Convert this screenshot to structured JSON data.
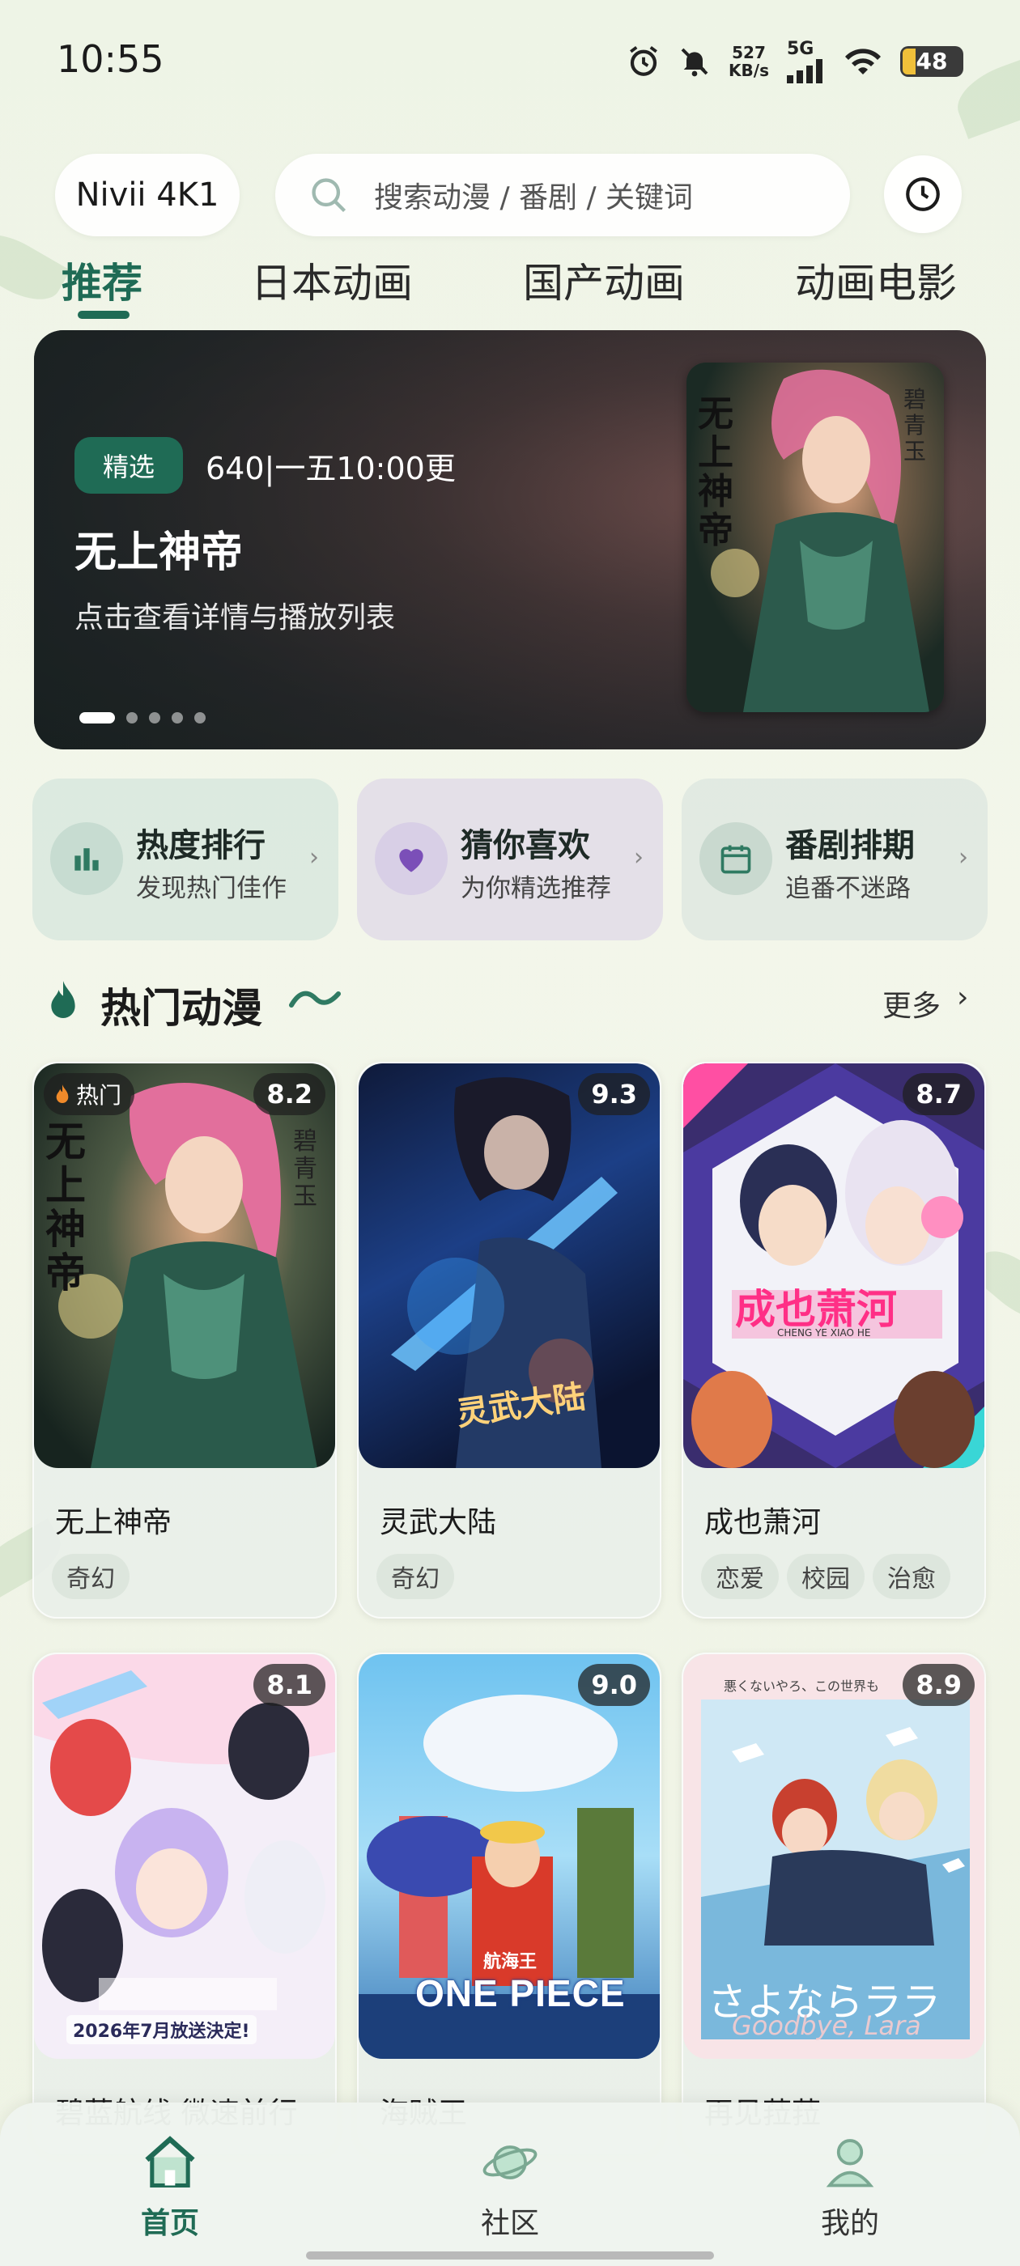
{
  "status_bar": {
    "time": "10:55",
    "net_speed_value": "527",
    "net_speed_unit": "KB/s",
    "network": "5G",
    "battery": "48"
  },
  "header": {
    "source_label": "Nivii 4K1",
    "search_placeholder": "搜索动漫 / 番剧 / 关键词"
  },
  "tabs": [
    {
      "label": "推荐",
      "active": true
    },
    {
      "label": "日本动画",
      "active": false
    },
    {
      "label": "国产动画",
      "active": false
    },
    {
      "label": "动画电影",
      "active": false
    }
  ],
  "banner": {
    "badge": "精选",
    "schedule": "640|一五10:00更",
    "title": "无上神帝",
    "subtitle": "点击查看详情与播放列表",
    "poster_text": "无上神帝",
    "poster_side_text": "碧青玉",
    "dots_total": 5,
    "active_dot": 1
  },
  "quick_links": [
    {
      "title": "热度排行",
      "subtitle": "发现热门佳作",
      "icon": "bar-chart-icon",
      "color": "#2f7a62"
    },
    {
      "title": "猜你喜欢",
      "subtitle": "为你精选推荐",
      "icon": "heart-icon",
      "color": "#7b4fb8"
    },
    {
      "title": "番剧排期",
      "subtitle": "追番不迷路",
      "icon": "calendar-icon",
      "color": "#2f7a62"
    }
  ],
  "section": {
    "title": "热门动漫",
    "more": "更多"
  },
  "anime_cards": [
    {
      "name": "无上神帝",
      "rating": "8.2",
      "hot": "热门",
      "tags": [
        "奇幻"
      ],
      "poster_text": "无上神帝",
      "poster_side_text": "碧青玉"
    },
    {
      "name": "灵武大陆",
      "rating": "9.3",
      "tags": [
        "奇幻"
      ],
      "poster_text": "灵武大陆"
    },
    {
      "name": "成也萧河",
      "rating": "8.7",
      "tags": [
        "恋爱",
        "校园",
        "治愈"
      ],
      "poster_text": "成也萧河",
      "poster_sub_text": "CHENG YE XIAO HE"
    },
    {
      "name": "碧蓝航线 微速前行",
      "rating": "8.1",
      "tags": [],
      "poster_text": "2026年7月放送決定!"
    },
    {
      "name": "海贼王",
      "rating": "9.0",
      "tags": [],
      "poster_text": "ONE PIECE",
      "poster_top_text": "航海王"
    },
    {
      "name": "再见菈菈",
      "rating": "8.9",
      "tags": [],
      "poster_text": "さよならララ",
      "poster_sub_text": "Goodbye, Lara",
      "poster_top_text": "悪くないやろ、この世界も"
    }
  ],
  "bottom_nav": [
    {
      "label": "首页",
      "icon": "home-icon",
      "active": true
    },
    {
      "label": "社区",
      "icon": "planet-icon",
      "active": false
    },
    {
      "label": "我的",
      "icon": "profile-icon",
      "active": false
    }
  ]
}
